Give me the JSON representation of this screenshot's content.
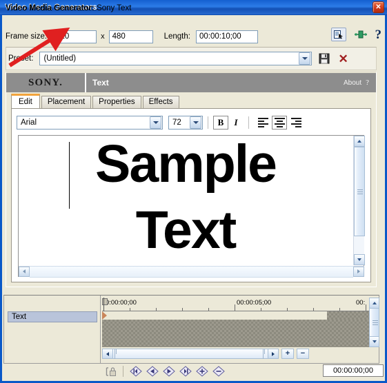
{
  "window": {
    "title": "Video Media Generators",
    "close_label": "✕"
  },
  "header": {
    "label": "Video Media Generator:",
    "value": "Sony Text"
  },
  "frame_settings": {
    "frame_size_label": "Frame size:",
    "width": "720",
    "x_separator": "x",
    "height": "480",
    "length_label": "Length:",
    "length": "00:00:10;00",
    "icons": {
      "match_output_aspect": "match-output-aspect-icon",
      "plugin_chain": "plugin-chain-icon",
      "help": "?"
    }
  },
  "preset": {
    "label": "Preset:",
    "value": "(Untitled)",
    "placeholder": "(Untitled)",
    "save_icon": "floppy-save-icon",
    "delete_icon": "✕"
  },
  "plugin": {
    "brand": "SONY.",
    "name": "Text",
    "about_label": "About",
    "help_label": "?"
  },
  "tabs": [
    {
      "label": "Edit",
      "active": true
    },
    {
      "label": "Placement",
      "active": false
    },
    {
      "label": "Properties",
      "active": false
    },
    {
      "label": "Effects",
      "active": false
    }
  ],
  "text_toolbar": {
    "font_family": "Arial",
    "font_size": "72",
    "bold_label": "B",
    "italic_label": "I",
    "align_left": "align-left-icon",
    "align_center": "align-center-icon",
    "align_right": "align-right-icon",
    "align_active": "center"
  },
  "editor": {
    "line1": "Sample",
    "line2": "Text"
  },
  "keyframes": {
    "track_name": "Text",
    "ruler_labels": [
      {
        "text": "0:00:00;00",
        "pos": 0
      },
      {
        "text": "00:00:05;00",
        "pos": 193
      },
      {
        "text": "00:",
        "pos": 365
      }
    ],
    "toolbar": {
      "lock_label": "lock-keyframe-icon",
      "first_label": "first-keyframe-icon",
      "previous_label": "previous-keyframe-icon",
      "next_label": "next-keyframe-icon",
      "last_label": "last-keyframe-icon",
      "add_label": "add-keyframe-icon",
      "delete_label": "delete-keyframe-icon"
    },
    "zoom_in_label": "+",
    "zoom_out_label": "−",
    "timecode": "00:00:00;00"
  },
  "colors": {
    "titlebar": "#1560d0",
    "accent_tab": "#f2a33c",
    "sony_bar": "#8d8d8d",
    "annotation_arrow": "#e02020",
    "selection": "#b9c4da"
  }
}
